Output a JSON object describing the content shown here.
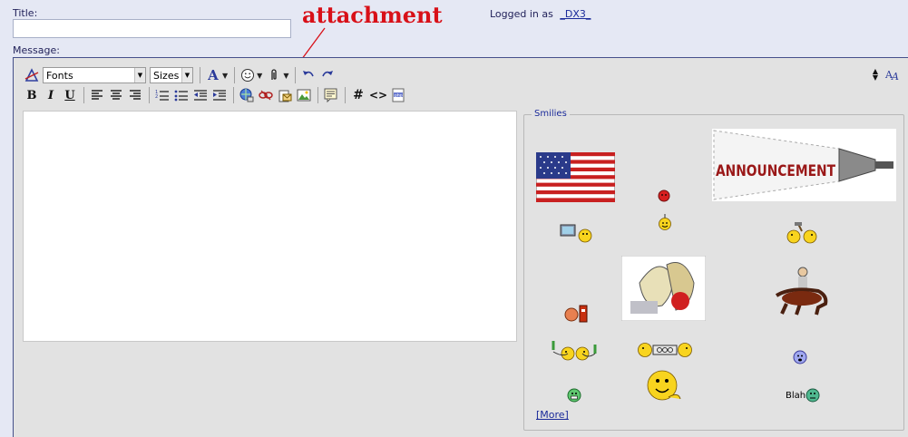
{
  "header": {
    "title_label": "Title:",
    "title_value": "",
    "logged_in_label": "Logged in as",
    "logged_in_user": "_DX3_",
    "message_label": "Message:"
  },
  "annotation": "attachment",
  "toolbar": {
    "font_select": "Fonts",
    "size_select": "Sizes",
    "buttons_row1": [
      "switch-mode",
      "font-color",
      "smilies",
      "attachment",
      "undo",
      "redo"
    ],
    "buttons_row2": [
      "bold",
      "italic",
      "underline",
      "align-left",
      "align-center",
      "align-right",
      "numbered-list",
      "bullet-list",
      "outdent",
      "indent",
      "insert-link",
      "remove-link",
      "email-link",
      "insert-image",
      "quote",
      "hash",
      "code",
      "php"
    ],
    "bold_glyph": "B",
    "italic_glyph": "I",
    "underline_glyph": "U",
    "hash_glyph": "#",
    "code_glyph": "<>"
  },
  "message": {
    "value": ""
  },
  "smilies": {
    "legend": "Smilies",
    "more_link": "[More]",
    "announcement_text": "ANNOUNCEMENT",
    "blah_text": "Blah"
  },
  "colors": {
    "background": "#e5e8f4",
    "editor_bg": "#e2e2e2",
    "annotation": "#d81018",
    "link": "#1a2a9a"
  }
}
